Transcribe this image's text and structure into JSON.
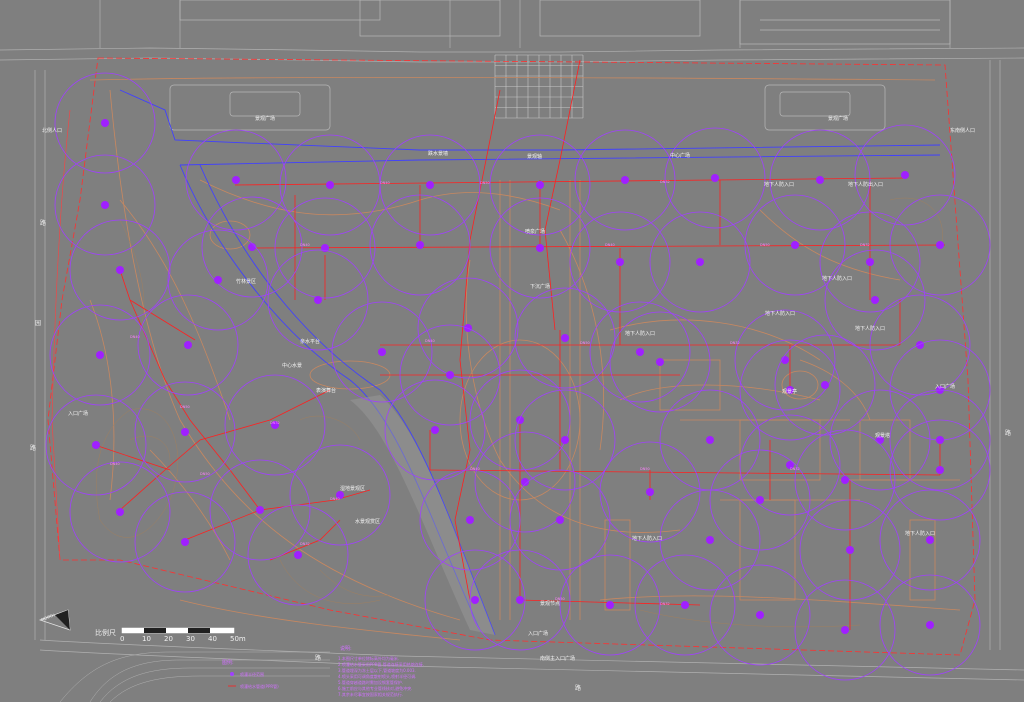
{
  "drawing": {
    "labels": [
      {
        "id": "ne-entrance",
        "text": "东南侧人口"
      },
      {
        "id": "nw-entrance",
        "text": "北侧人口"
      },
      {
        "id": "north-square",
        "text": "景观广场"
      },
      {
        "id": "north-square-2",
        "text": "景观广场"
      },
      {
        "id": "water-feature",
        "text": "跌水景墙"
      },
      {
        "id": "landscape-axis",
        "text": "景观轴"
      },
      {
        "id": "central-plaza",
        "text": "中心广场"
      },
      {
        "id": "fountain",
        "text": "喷泉广场"
      },
      {
        "id": "ug-entrance-1",
        "text": "地下人防入口"
      },
      {
        "id": "ug-entrance-2",
        "text": "地下人防出入口"
      },
      {
        "id": "ug-entrance-3",
        "text": "地下人防入口"
      },
      {
        "id": "ug-entrance-4",
        "text": "地下人防入口"
      },
      {
        "id": "ug-entrance-5",
        "text": "地下人防入口"
      },
      {
        "id": "ug-entrance-6",
        "text": "地下人防入口"
      },
      {
        "id": "ug-entrance-7",
        "text": "地下人防入口"
      },
      {
        "id": "ug-entrance-8",
        "text": "地下人防入口"
      },
      {
        "id": "west-square",
        "text": "入口广场"
      },
      {
        "id": "south-square",
        "text": "入口广场"
      },
      {
        "id": "east-square",
        "text": "入口广场"
      },
      {
        "id": "east-tower",
        "text": "观景塔"
      },
      {
        "id": "pavilion",
        "text": "观景亭"
      },
      {
        "id": "waterside-pavilion",
        "text": "亲水平台"
      },
      {
        "id": "waterscape",
        "text": "水景观赏区"
      },
      {
        "id": "wetland",
        "text": "湿地景观区"
      },
      {
        "id": "bamboo",
        "text": "竹林景区"
      },
      {
        "id": "sunken",
        "text": "下沉广场"
      },
      {
        "id": "pool",
        "text": "中心水景"
      },
      {
        "id": "stage",
        "text": "表演舞台"
      },
      {
        "id": "sw-node",
        "text": "景观节点"
      },
      {
        "id": "south-gate",
        "text": "南侧主入口广场"
      }
    ],
    "roads": [
      {
        "id": "road-w1",
        "text": "路"
      },
      {
        "id": "road-w2",
        "text": "园"
      },
      {
        "id": "road-w3",
        "text": "路"
      },
      {
        "id": "road-s1",
        "text": "路"
      },
      {
        "id": "road-s2",
        "text": "路"
      },
      {
        "id": "road-e1",
        "text": "路"
      }
    ],
    "pipe_tags": [
      "DN40",
      "DN50",
      "DN32"
    ]
  },
  "scale_bar": {
    "title": "比例尺",
    "ticks": [
      "0",
      "10",
      "20",
      "30",
      "40",
      "50m"
    ]
  },
  "north_arrow": {
    "label": "NORTH"
  },
  "legend": {
    "title": "图例:",
    "items": [
      {
        "text": "喷灌半径范围"
      },
      {
        "text": "喷灌给水管道(PPR管)"
      }
    ]
  },
  "notes": {
    "title": "说明:",
    "lines": [
      "1.本图尺寸单位除标高外均为毫米.",
      "2.喷灌给水管采用PPR管,管道连接采用热熔连接.",
      "3.管道埋深为冻土层以下,管道坡度为0.003.",
      "4.喷头采用可调角度散射喷头,喷射半径可调.",
      "5.管道穿越道路时需加设钢套管保护.",
      "6.施工前应与其他专业管线核对,避免冲突.",
      "7.其余未尽事宜按国家相关规范执行."
    ]
  },
  "colors": {
    "background": "#7f7f7f",
    "sprinkler_circle": "#a040ff",
    "pipe": "#ff2020",
    "boundary": "#ff3030",
    "path": "#c88860",
    "building": "#b8b8b8",
    "river": "#4040ff"
  }
}
